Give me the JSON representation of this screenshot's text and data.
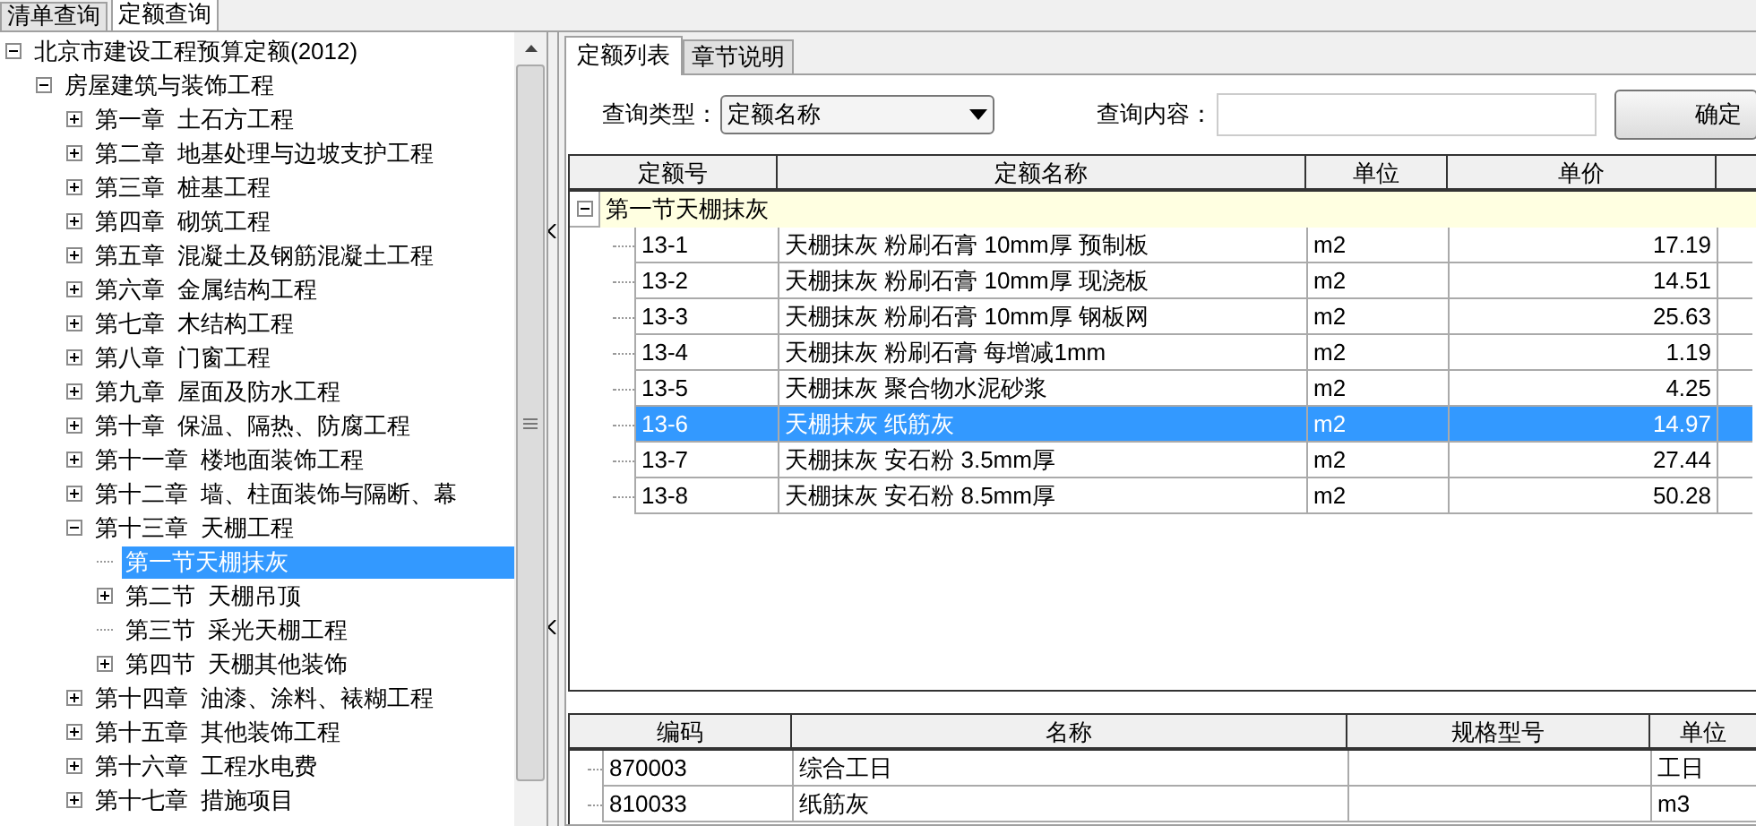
{
  "top_tabs": [
    {
      "label": "清单查询",
      "selected": false
    },
    {
      "label": "定额查询",
      "selected": true
    }
  ],
  "tree": [
    {
      "label": "北京市建设工程预算定额(2012)",
      "expanded": true,
      "selected": false,
      "children": [
        {
          "label": "房屋建筑与装饰工程",
          "expanded": true,
          "selected": false,
          "children": [
            {
              "label": "第一章  土石方工程",
              "expanded": false,
              "selected": false
            },
            {
              "label": "第二章  地基处理与边坡支护工程",
              "expanded": false,
              "selected": false
            },
            {
              "label": "第三章  桩基工程",
              "expanded": false,
              "selected": false
            },
            {
              "label": "第四章  砌筑工程",
              "expanded": false,
              "selected": false
            },
            {
              "label": "第五章  混凝土及钢筋混凝土工程",
              "expanded": false,
              "selected": false
            },
            {
              "label": "第六章  金属结构工程",
              "expanded": false,
              "selected": false
            },
            {
              "label": "第七章  木结构工程",
              "expanded": false,
              "selected": false
            },
            {
              "label": "第八章  门窗工程",
              "expanded": false,
              "selected": false
            },
            {
              "label": "第九章  屋面及防水工程",
              "expanded": false,
              "selected": false
            },
            {
              "label": "第十章  保温、隔热、防腐工程",
              "expanded": false,
              "selected": false
            },
            {
              "label": "第十一章  楼地面装饰工程",
              "expanded": false,
              "selected": false
            },
            {
              "label": "第十二章  墙、柱面装饰与隔断、幕",
              "expanded": false,
              "selected": false
            },
            {
              "label": "第十三章  天棚工程",
              "expanded": true,
              "selected": false,
              "children": [
                {
                  "label": "第一节天棚抹灰",
                  "selected": true
                },
                {
                  "label": "第二节  天棚吊顶",
                  "expanded": false,
                  "selected": false
                },
                {
                  "label": "第三节  采光天棚工程",
                  "selected": false
                },
                {
                  "label": "第四节  天棚其他装饰",
                  "expanded": false,
                  "selected": false
                }
              ]
            },
            {
              "label": "第十四章  油漆、涂料、裱糊工程",
              "expanded": false,
              "selected": false
            },
            {
              "label": "第十五章  其他装饰工程",
              "expanded": false,
              "selected": false
            },
            {
              "label": "第十六章  工程水电费",
              "expanded": false,
              "selected": false
            },
            {
              "label": "第十七章  措施项目",
              "expanded": false,
              "selected": false
            }
          ]
        }
      ]
    }
  ],
  "right_tabs": [
    {
      "label": "定额列表",
      "selected": true
    },
    {
      "label": "章节说明",
      "selected": false
    }
  ],
  "query": {
    "type_label": "查询类型：",
    "type_value": "定额名称",
    "content_label": "查询内容：",
    "button": "确定"
  },
  "quota_table": {
    "columns": [
      "定额号",
      "定额名称",
      "单位",
      "单价"
    ],
    "group": {
      "label": "第一节天棚抹灰",
      "expanded": true
    },
    "rows": [
      {
        "code": "13-1",
        "name": "天棚抹灰 粉刷石膏 10mm厚 预制板",
        "unit": "m2",
        "price": "17.19",
        "selected": false
      },
      {
        "code": "13-2",
        "name": "天棚抹灰 粉刷石膏 10mm厚 现浇板",
        "unit": "m2",
        "price": "14.51",
        "selected": false
      },
      {
        "code": "13-3",
        "name": "天棚抹灰 粉刷石膏 10mm厚 钢板网",
        "unit": "m2",
        "price": "25.63",
        "selected": false
      },
      {
        "code": "13-4",
        "name": "天棚抹灰 粉刷石膏 每增减1mm",
        "unit": "m2",
        "price": "1.19",
        "selected": false
      },
      {
        "code": "13-5",
        "name": "天棚抹灰 聚合物水泥砂浆",
        "unit": "m2",
        "price": "4.25",
        "selected": false
      },
      {
        "code": "13-6",
        "name": "天棚抹灰 纸筋灰",
        "unit": "m2",
        "price": "14.97",
        "selected": true
      },
      {
        "code": "13-7",
        "name": "天棚抹灰 安石粉 3.5mm厚",
        "unit": "m2",
        "price": "27.44",
        "selected": false
      },
      {
        "code": "13-8",
        "name": "天棚抹灰 安石粉 8.5mm厚",
        "unit": "m2",
        "price": "50.28",
        "selected": false
      }
    ]
  },
  "material_table": {
    "columns": [
      "编码",
      "名称",
      "规格型号",
      "单位"
    ],
    "rows": [
      {
        "code": "870003",
        "name": "综合工日",
        "unit": "工日"
      },
      {
        "code": "810033",
        "name": "纸筋灰",
        "unit": "m3"
      }
    ]
  }
}
